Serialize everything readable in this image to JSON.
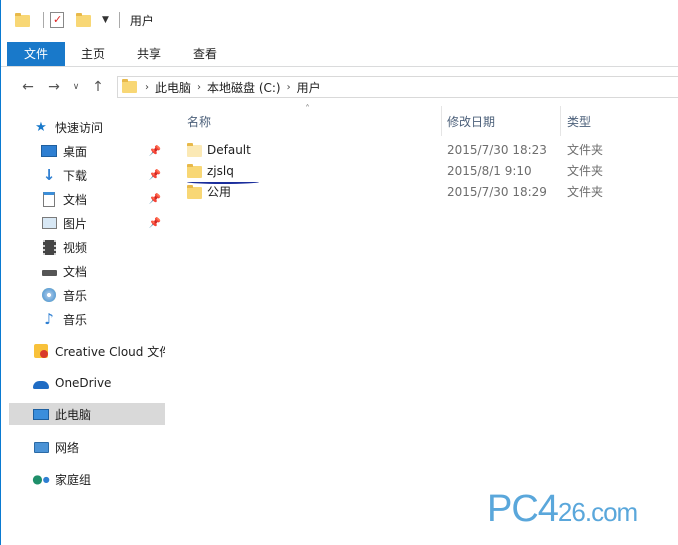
{
  "window": {
    "title": "用户"
  },
  "ribbon": {
    "tabs": [
      "文件",
      "主页",
      "共享",
      "查看"
    ]
  },
  "address": {
    "crumbs": [
      "此电脑",
      "本地磁盘 (C:)",
      "用户"
    ]
  },
  "nav": {
    "items": [
      {
        "label": "快速访问",
        "icon": "star-icon",
        "pinned": false,
        "sub": false
      },
      {
        "label": "桌面",
        "icon": "desktop-icon",
        "pinned": true,
        "sub": true
      },
      {
        "label": "下载",
        "icon": "download-icon",
        "pinned": true,
        "sub": true
      },
      {
        "label": "文档",
        "icon": "documents-icon",
        "pinned": true,
        "sub": true
      },
      {
        "label": "图片",
        "icon": "pictures-icon",
        "pinned": true,
        "sub": true
      },
      {
        "label": "视频",
        "icon": "video-icon",
        "pinned": false,
        "sub": true
      },
      {
        "label": "文档",
        "icon": "drive-icon",
        "pinned": false,
        "sub": true
      },
      {
        "label": "音乐",
        "icon": "disc-icon",
        "pinned": false,
        "sub": true
      },
      {
        "label": "音乐",
        "icon": "music-icon",
        "pinned": false,
        "sub": true
      },
      {
        "label": "Creative Cloud 文件",
        "icon": "creative-cloud-icon",
        "pinned": false,
        "sub": false
      },
      {
        "label": "OneDrive",
        "icon": "onedrive-icon",
        "pinned": false,
        "sub": false
      },
      {
        "label": "此电脑",
        "icon": "computer-icon",
        "pinned": false,
        "sub": false,
        "selected": true
      },
      {
        "label": "网络",
        "icon": "network-icon",
        "pinned": false,
        "sub": false
      },
      {
        "label": "家庭组",
        "icon": "homegroup-icon",
        "pinned": false,
        "sub": false
      }
    ]
  },
  "columns": {
    "name": "名称",
    "date": "修改日期",
    "type": "类型"
  },
  "files": [
    {
      "name": "Default",
      "date": "2015/7/30 18:23",
      "type": "文件夹"
    },
    {
      "name": "zjslq",
      "date": "2015/8/1 9:10",
      "type": "文件夹"
    },
    {
      "name": "公用",
      "date": "2015/7/30 18:29",
      "type": "文件夹"
    }
  ],
  "watermark": {
    "text": "PC4",
    "text2": "26.com"
  },
  "colors": {
    "accent": "#1979ca",
    "selected_nav": "#d9d9d9",
    "folder": "#f8d775",
    "watermark": "#5aa7db"
  }
}
